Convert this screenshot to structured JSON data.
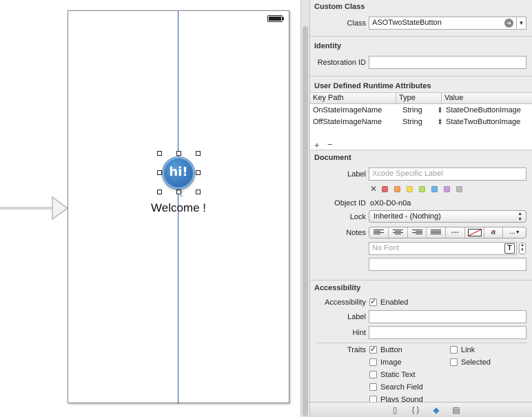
{
  "canvas": {
    "button_text": "hi!",
    "welcome_label": "Welcome !"
  },
  "inspector": {
    "custom_class": {
      "title": "Custom Class",
      "class_label": "Class",
      "class_value": "ASOTwoStateButton"
    },
    "identity": {
      "title": "Identity",
      "restoration_id_label": "Restoration ID",
      "restoration_id_value": ""
    },
    "runtime_attributes": {
      "title": "User Defined Runtime Attributes",
      "columns": [
        "Key Path",
        "Type",
        "Value"
      ],
      "rows": [
        {
          "key_path": "OnStateImageName",
          "type": "String",
          "value": "StateOneButtonImage"
        },
        {
          "key_path": "OffStateImageName",
          "type": "String",
          "value": "StateTwoButtonImage"
        }
      ],
      "add_symbol": "+",
      "remove_symbol": "−"
    },
    "document": {
      "title": "Document",
      "label_label": "Label",
      "label_placeholder": "Xcode Specific Label",
      "label_colors": [
        "#e26a6a",
        "#f0a35a",
        "#f2dc5d",
        "#b5de6a",
        "#6db3ea",
        "#c89be0",
        "#bcbcbc"
      ],
      "object_id_label": "Object ID",
      "object_id_value": "oX0-D0-n0a",
      "lock_label": "Lock",
      "lock_value": "Inherited - (Nothing)",
      "notes_label": "Notes",
      "font_placeholder": "No Font",
      "more_symbol": "...",
      "dashes_symbol": "---",
      "strike_symbol": "a"
    },
    "accessibility": {
      "title": "Accessibility",
      "accessibility_label": "Accessibility",
      "enabled_label": "Enabled",
      "enabled_checked": true,
      "label_label": "Label",
      "hint_label": "Hint",
      "traits_label": "Traits",
      "traits": [
        {
          "label": "Button",
          "checked": true
        },
        {
          "label": "Link",
          "checked": false
        },
        {
          "label": "Image",
          "checked": false
        },
        {
          "label": "Selected",
          "checked": false
        },
        {
          "label": "Static Text",
          "checked": false
        },
        {
          "label": "Search Field",
          "checked": false
        },
        {
          "label": "Plays Sound",
          "checked": false
        }
      ]
    }
  },
  "library_tabs": [
    {
      "icon": "file-template-icon",
      "glyph": "▯"
    },
    {
      "icon": "code-snippet-icon",
      "glyph": "{ }"
    },
    {
      "icon": "object-library-icon",
      "glyph": "◆"
    },
    {
      "icon": "media-library-icon",
      "glyph": "▤"
    }
  ]
}
